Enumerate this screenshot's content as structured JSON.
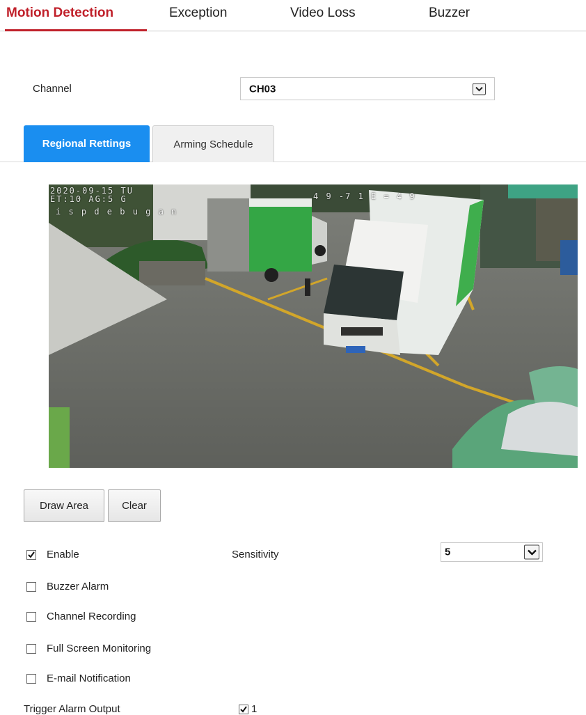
{
  "top_tabs": [
    {
      "label": "Motion Detection"
    },
    {
      "label": "Exception"
    },
    {
      "label": "Video Loss"
    },
    {
      "label": "Buzzer"
    }
  ],
  "channel": {
    "label": "Channel",
    "selected": "CH03"
  },
  "sub_tabs": [
    {
      "label": "Regional Rettings"
    },
    {
      "label": "Arming Schedule"
    }
  ],
  "video": {
    "osd_datetime": "2020-09-15 TU",
    "osd_line2": "ET:10 AG:5 G",
    "osd_line3": "i s p d e b u g a  n",
    "osd_right": "4 9 -7 1 E = 4 9"
  },
  "buttons": {
    "draw_area": "Draw Area",
    "clear": "Clear"
  },
  "options": [
    {
      "label": "Enable",
      "checked": true
    },
    {
      "label": "Buzzer Alarm",
      "checked": false
    },
    {
      "label": "Channel Recording",
      "checked": false
    },
    {
      "label": "Full Screen Monitoring",
      "checked": false
    },
    {
      "label": "E-mail Notification",
      "checked": false
    }
  ],
  "sensitivity": {
    "label": "Sensitivity",
    "value": "5"
  },
  "trigger_alarm": {
    "label": "Trigger Alarm Output",
    "output_label": "1",
    "checked": true
  },
  "colors": {
    "accent_red": "#c0202a",
    "accent_blue": "#1a8ef0"
  }
}
